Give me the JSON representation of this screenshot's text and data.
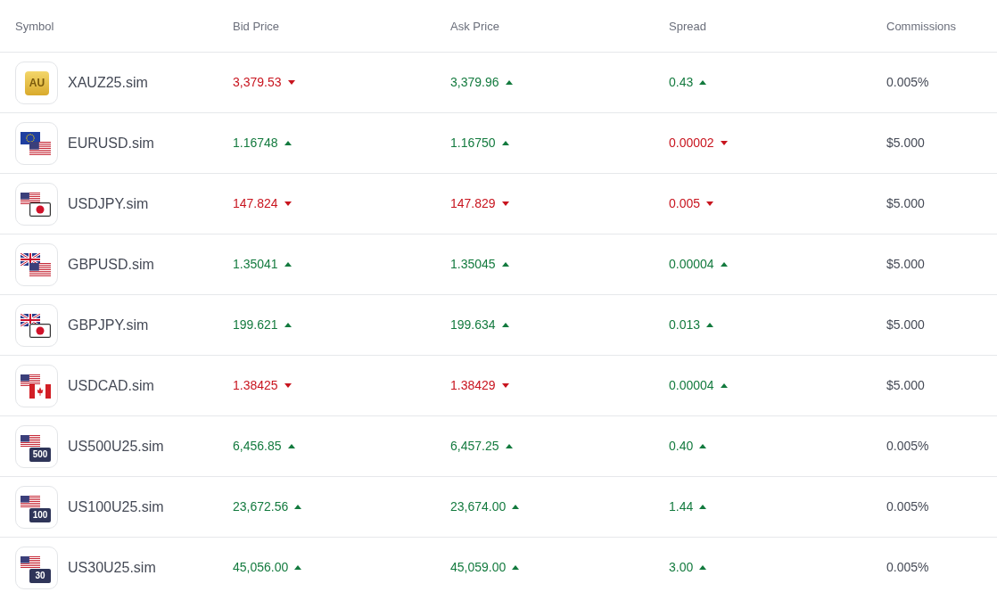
{
  "table": {
    "columns": [
      "Symbol",
      "Bid Price",
      "Ask Price",
      "Spread",
      "Commissions"
    ],
    "rows": [
      {
        "symbol": "XAUZ25.sim",
        "icon": {
          "kind": "metal",
          "text": "AU"
        },
        "bid": {
          "value": "3,379.53",
          "rising": false
        },
        "ask": {
          "value": "3,379.96",
          "rising": true
        },
        "spread": {
          "value": "0.43",
          "rising": true
        },
        "commission": "0.005%"
      },
      {
        "symbol": "EURUSD.sim",
        "icon": {
          "kind": "pair",
          "flags": [
            {
              "kind": "eu"
            },
            {
              "kind": "us"
            }
          ]
        },
        "bid": {
          "value": "1.16748",
          "rising": true
        },
        "ask": {
          "value": "1.16750",
          "rising": true
        },
        "spread": {
          "value": "0.00002",
          "rising": false
        },
        "commission": "$5.000"
      },
      {
        "symbol": "USDJPY.sim",
        "icon": {
          "kind": "pair",
          "flags": [
            {
              "kind": "us"
            },
            {
              "kind": "jp"
            }
          ]
        },
        "bid": {
          "value": "147.824",
          "rising": false
        },
        "ask": {
          "value": "147.829",
          "rising": false
        },
        "spread": {
          "value": "0.005",
          "rising": false
        },
        "commission": "$5.000"
      },
      {
        "symbol": "GBPUSD.sim",
        "icon": {
          "kind": "pair",
          "flags": [
            {
              "kind": "gb"
            },
            {
              "kind": "us"
            }
          ]
        },
        "bid": {
          "value": "1.35041",
          "rising": true
        },
        "ask": {
          "value": "1.35045",
          "rising": true
        },
        "spread": {
          "value": "0.00004",
          "rising": true
        },
        "commission": "$5.000"
      },
      {
        "symbol": "GBPJPY.sim",
        "icon": {
          "kind": "pair",
          "flags": [
            {
              "kind": "gb"
            },
            {
              "kind": "jp"
            }
          ]
        },
        "bid": {
          "value": "199.621",
          "rising": true
        },
        "ask": {
          "value": "199.634",
          "rising": true
        },
        "spread": {
          "value": "0.013",
          "rising": true
        },
        "commission": "$5.000"
      },
      {
        "symbol": "USDCAD.sim",
        "icon": {
          "kind": "pair",
          "flags": [
            {
              "kind": "us"
            },
            {
              "kind": "ca"
            }
          ]
        },
        "bid": {
          "value": "1.38425",
          "rising": false
        },
        "ask": {
          "value": "1.38429",
          "rising": false
        },
        "spread": {
          "value": "0.00004",
          "rising": true
        },
        "commission": "$5.000"
      },
      {
        "symbol": "US500U25.sim",
        "icon": {
          "kind": "index",
          "flags": [
            {
              "kind": "us"
            }
          ],
          "text": "500"
        },
        "bid": {
          "value": "6,456.85",
          "rising": true
        },
        "ask": {
          "value": "6,457.25",
          "rising": true
        },
        "spread": {
          "value": "0.40",
          "rising": true
        },
        "commission": "0.005%"
      },
      {
        "symbol": "US100U25.sim",
        "icon": {
          "kind": "index",
          "flags": [
            {
              "kind": "us"
            }
          ],
          "text": "100"
        },
        "bid": {
          "value": "23,672.56",
          "rising": true
        },
        "ask": {
          "value": "23,674.00",
          "rising": true
        },
        "spread": {
          "value": "1.44",
          "rising": true
        },
        "commission": "0.005%"
      },
      {
        "symbol": "US30U25.sim",
        "icon": {
          "kind": "index",
          "flags": [
            {
              "kind": "us"
            }
          ],
          "text": "30"
        },
        "bid": {
          "value": "45,056.00",
          "rising": true
        },
        "ask": {
          "value": "45,059.00",
          "rising": true
        },
        "spread": {
          "value": "3.00",
          "rising": true
        },
        "commission": "0.005%"
      }
    ]
  }
}
